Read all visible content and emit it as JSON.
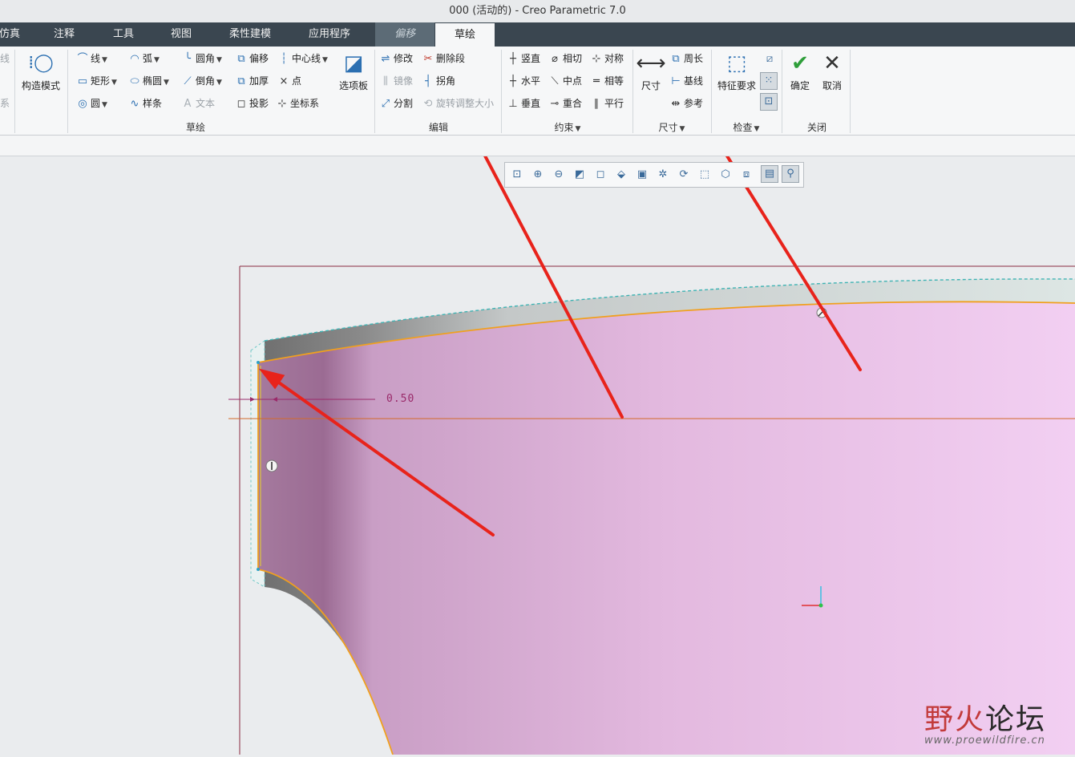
{
  "window": {
    "title": "000 (活动的) - Creo Parametric 7.0"
  },
  "tabs": [
    "仿真",
    "注释",
    "工具",
    "视图",
    "柔性建模",
    "应用程序",
    "偏移",
    "草绘"
  ],
  "active_tab": "草绘",
  "ribbon": {
    "edge": [
      "线",
      "系"
    ],
    "construct_mode": "构造模式",
    "sketch": {
      "line": "线",
      "arc": "弧",
      "fillet": "圆角",
      "offset": "偏移",
      "centerline": "中心线",
      "rect": "矩形",
      "ellipse": "椭圆",
      "chamfer": "倒角",
      "thicken": "加厚",
      "point": "点",
      "circle": "圆",
      "spline": "样条",
      "text": "文本",
      "project": "投影",
      "csys": "坐标系",
      "palette": "选项板",
      "group": "草绘"
    },
    "edit": {
      "modify": "修改",
      "delete_segment": "删除段",
      "mirror": "镜像",
      "corner": "拐角",
      "divide": "分割",
      "rotate_resize": "旋转调整大小",
      "group": "编辑"
    },
    "constrain": {
      "vertical": "竖直",
      "tangent": "相切",
      "symmetric": "对称",
      "horizontal": "水平",
      "midpoint": "中点",
      "equal": "相等",
      "perpendicular": "垂直",
      "coincident": "重合",
      "parallel": "平行",
      "group": "约束"
    },
    "dimension": {
      "dimension": "尺寸",
      "perimeter": "周长",
      "baseline": "基线",
      "reference": "参考",
      "group": "尺寸"
    },
    "inspect": {
      "feature_requirements": "特征要求",
      "group": "检查"
    },
    "close": {
      "ok": "确定",
      "cancel": "取消",
      "group": "关闭"
    }
  },
  "graphics_toolbar": [
    "refit",
    "zoom-in",
    "zoom-out",
    "repaint",
    "display-style",
    "saved-views",
    "view-manager",
    "datum-display",
    "spin-center",
    "annotation-display",
    "3d-view",
    "sketch-view",
    "sketch-display-filter",
    "constraint-display"
  ],
  "canvas": {
    "dimension_value": "0.50"
  },
  "watermark": {
    "cn_red": "野火",
    "cn_black": "论坛",
    "url": "www.proewildfire.cn"
  },
  "colors": {
    "tab_bar": "#3a4650",
    "ribbon_bg": "#f6f7f8",
    "part_fill": "#e6b8e0",
    "sketch_edge": "#f0a01e",
    "arrow": "#e8231b",
    "dimension": "#9a2a6a"
  }
}
